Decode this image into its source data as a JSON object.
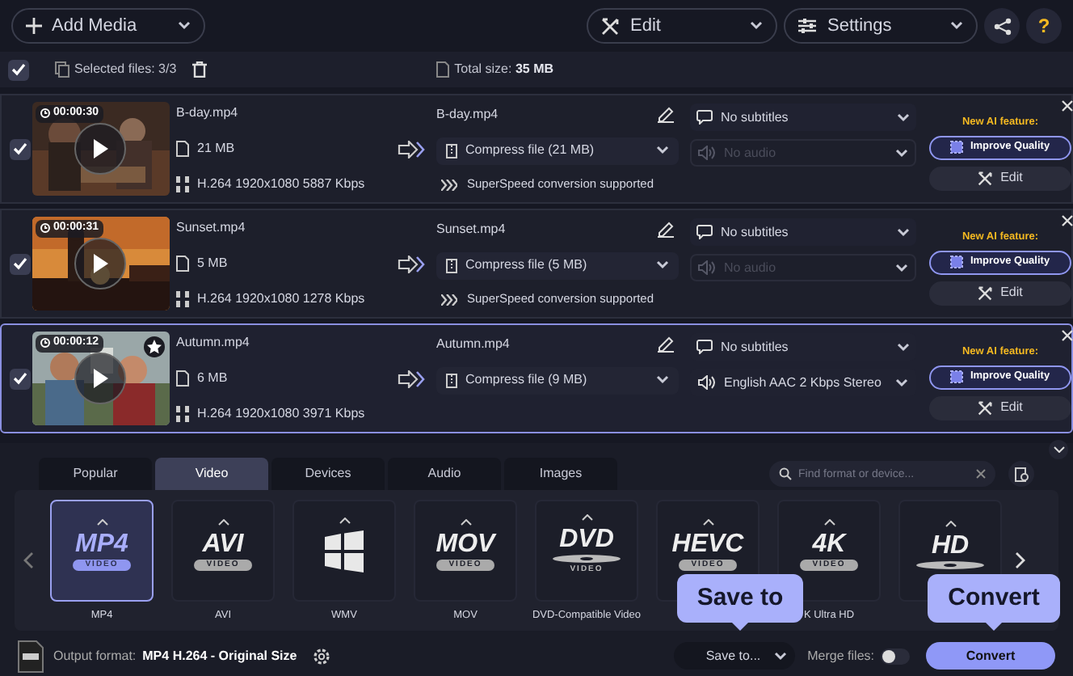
{
  "toolbar": {
    "add_media": "Add Media",
    "edit": "Edit",
    "settings": "Settings",
    "help": "?"
  },
  "selection_bar": {
    "checked": true,
    "selected_files": "Selected files: 3/3",
    "total_size_label": "Total size:",
    "total_size": "35 MB"
  },
  "files": [
    {
      "checked": true,
      "selected": false,
      "starred": false,
      "duration": "00:00:30",
      "name": "B-day.mp4",
      "size": "21 MB",
      "codec": "H.264 1920x1080 5887 Kbps",
      "output_name": "B-day.mp4",
      "compress": "Compress file (21 MB)",
      "note": "SuperSpeed conversion supported",
      "subtitles": "No subtitles",
      "audio": "No audio",
      "audio_disabled": true,
      "ai_label": "New AI feature:",
      "improve": "Improve Quality",
      "edit": "Edit"
    },
    {
      "checked": true,
      "selected": false,
      "starred": false,
      "duration": "00:00:31",
      "name": "Sunset.mp4",
      "size": "5 MB",
      "codec": "H.264 1920x1080 1278 Kbps",
      "output_name": "Sunset.mp4",
      "compress": "Compress file (5 MB)",
      "note": "SuperSpeed conversion supported",
      "subtitles": "No subtitles",
      "audio": "No audio",
      "audio_disabled": true,
      "ai_label": "New AI feature:",
      "improve": "Improve Quality",
      "edit": "Edit"
    },
    {
      "checked": true,
      "selected": true,
      "starred": true,
      "duration": "00:00:12",
      "name": "Autumn.mp4",
      "size": "6 MB",
      "codec": "H.264 1920x1080 3971 Kbps",
      "output_name": "Autumn.mp4",
      "compress": "Compress file (9 MB)",
      "subtitles": "No subtitles",
      "audio": "English AAC 2 Kbps Stereo",
      "audio_disabled": false,
      "ai_label": "New AI feature:",
      "improve": "Improve Quality",
      "edit": "Edit"
    }
  ],
  "format_tabs": [
    {
      "label": "Popular",
      "selected": false
    },
    {
      "label": "Video",
      "selected": true
    },
    {
      "label": "Devices",
      "selected": false
    },
    {
      "label": "Audio",
      "selected": false
    },
    {
      "label": "Images",
      "selected": false
    }
  ],
  "search": {
    "placeholder": "Find format or device..."
  },
  "formats": [
    {
      "kind": "logo",
      "logo": "MP4",
      "sub": "VIDEO",
      "label": "MP4",
      "selected": true
    },
    {
      "kind": "logo",
      "logo": "AVI",
      "sub": "VIDEO",
      "label": "AVI",
      "selected": false
    },
    {
      "kind": "windows",
      "label": "WMV",
      "selected": false
    },
    {
      "kind": "logo",
      "logo": "MOV",
      "sub": "VIDEO",
      "label": "MOV",
      "selected": false
    },
    {
      "kind": "disc",
      "logo": "DVD",
      "sub": "VIDEO",
      "label": "DVD-Compatible Video",
      "selected": false
    },
    {
      "kind": "logo",
      "logo": "HEVC",
      "sub": "VIDEO",
      "selected": false
    },
    {
      "kind": "logo",
      "logo": "4K",
      "sub": "VIDEO",
      "label": "K Ultra HD",
      "selected": false
    },
    {
      "kind": "disc",
      "logo": "HD",
      "selected": false
    }
  ],
  "bottom_bar": {
    "output_label": "Output format:",
    "output_value": "MP4 H.264 - Original Size",
    "save_to": "Save to...",
    "merge_label": "Merge files:",
    "merge_on": false,
    "convert": "Convert"
  },
  "tooltips": [
    {
      "text": "Save to"
    },
    {
      "text": "Convert"
    }
  ]
}
